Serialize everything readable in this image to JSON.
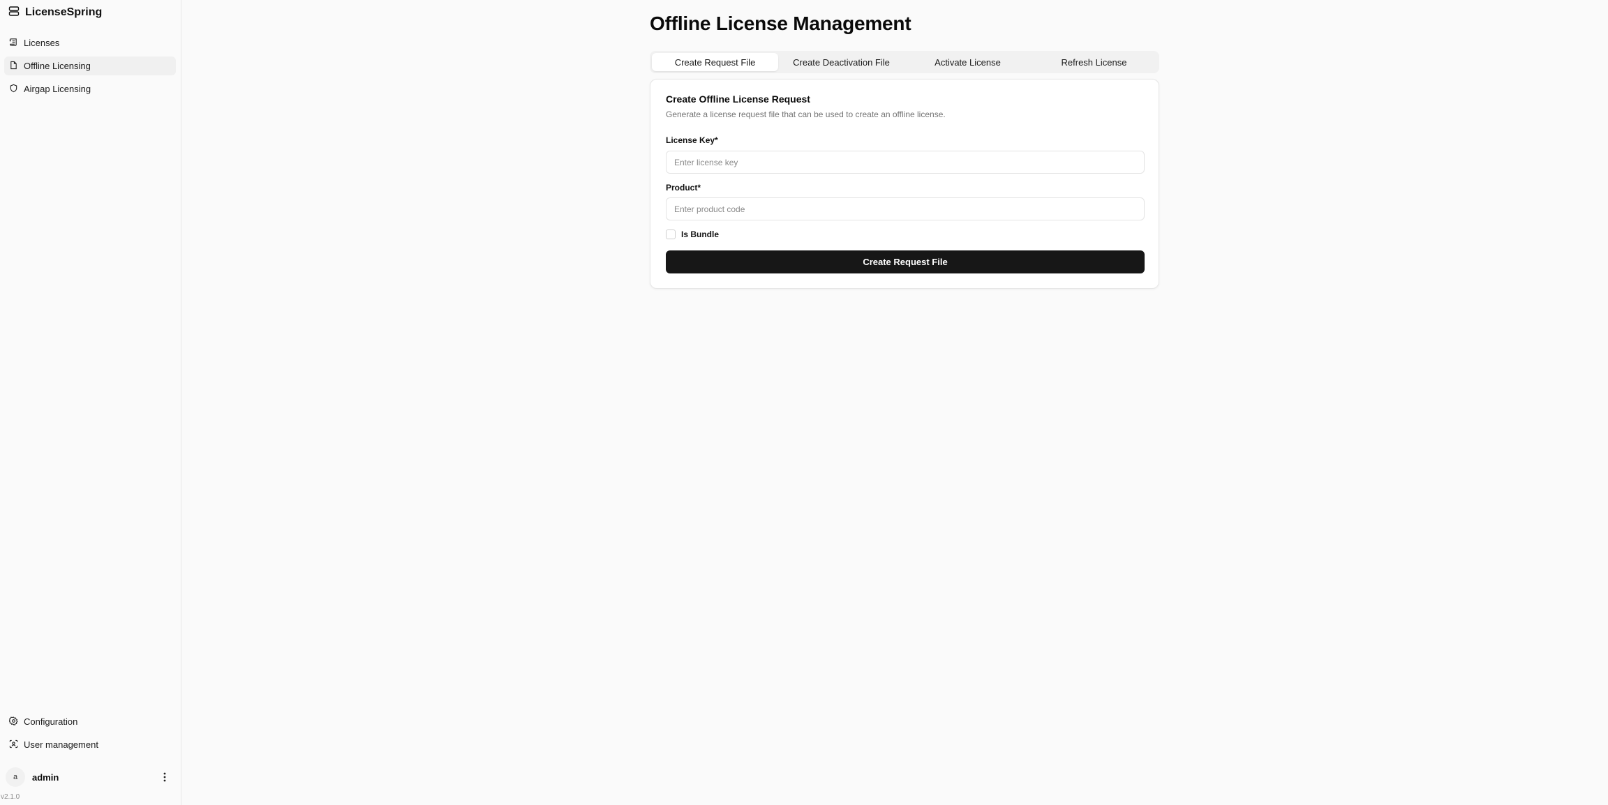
{
  "sidebar": {
    "brand": "LicenseSpring",
    "items": [
      {
        "label": "Licenses",
        "icon": "scroll-icon"
      },
      {
        "label": "Offline Licensing",
        "icon": "file-icon",
        "active": true
      },
      {
        "label": "Airgap Licensing",
        "icon": "shield-icon"
      }
    ],
    "footer_items": [
      {
        "label": "Configuration",
        "icon": "gear-icon"
      },
      {
        "label": "User management",
        "icon": "user-scan-icon"
      }
    ],
    "user": {
      "avatar_initial": "a",
      "name": "admin"
    },
    "version": "v2.1.0"
  },
  "main": {
    "title": "Offline License Management",
    "tabs": [
      {
        "label": "Create Request File",
        "active": true
      },
      {
        "label": "Create Deactivation File"
      },
      {
        "label": "Activate License"
      },
      {
        "label": "Refresh License"
      }
    ],
    "card": {
      "title": "Create Offline License Request",
      "description": "Generate a license request file that can be used to create an offline license.",
      "license_key_label": "License Key*",
      "license_key_placeholder": "Enter license key",
      "product_label": "Product*",
      "product_placeholder": "Enter product code",
      "bundle_label": "Is Bundle",
      "submit_label": "Create Request File"
    }
  }
}
